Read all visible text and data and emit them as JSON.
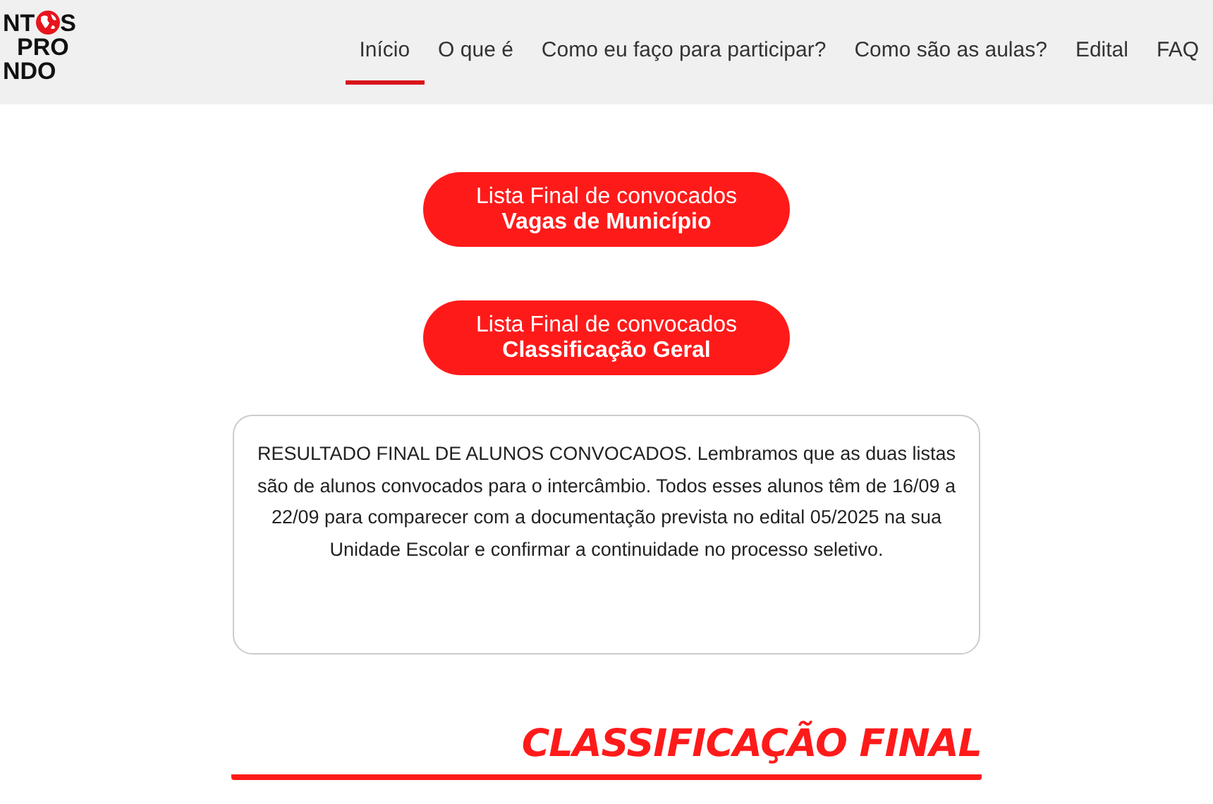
{
  "header": {
    "logo": {
      "line_1_start": "NT",
      "line_1_end": "S",
      "line_2": "PRO",
      "line_3": "NDO"
    },
    "nav": [
      {
        "label": "Início",
        "selected": true
      },
      {
        "label": "O que é",
        "selected": false
      },
      {
        "label": "Como eu faço para participar?",
        "selected": false
      },
      {
        "label": "Como são as aulas?",
        "selected": false
      },
      {
        "label": "Edital",
        "selected": false
      },
      {
        "label": "FAQ",
        "selected": false
      }
    ]
  },
  "buttons": [
    {
      "line_1": "Lista Final de convocados",
      "line_2": "Vagas de Município"
    },
    {
      "line_1": "Lista Final de convocados",
      "line_2": "Classificação Geral"
    }
  ],
  "notice": "RESULTADO FINAL DE ALUNOS CONVOCADOS. Lembramos que as duas listas são de alunos convocados para o intercâmbio. Todos esses alunos têm de 16/09 a 22/09 para comparecer com a documentação prevista no edital 05/2025 na sua Unidade Escolar e confirmar a continuidade no processo seletivo.",
  "section_heading": "CLASSIFICAÇÃO FINAL"
}
